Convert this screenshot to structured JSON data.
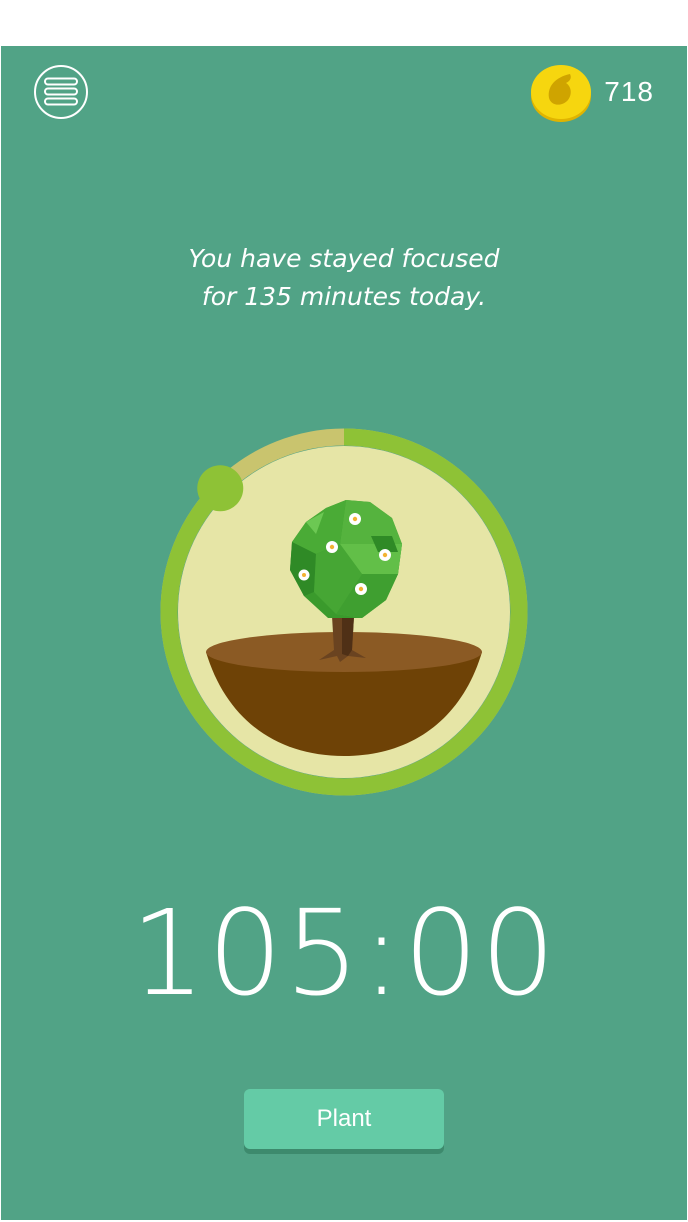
{
  "header": {
    "menu_icon": "hamburger-menu-icon",
    "coin_icon": "gold-coin-icon",
    "coin_count": "718"
  },
  "focus_message": {
    "line1": "You have stayed focused",
    "line2": "for 135 minutes today."
  },
  "tree": {
    "illustration": "tree-with-flowers-on-soil",
    "progress_fraction": 0.875
  },
  "timer": {
    "display": "105:00"
  },
  "actions": {
    "plant_label": "Plant"
  },
  "colors": {
    "background": "#51a386",
    "ring_progress": "#8ec236",
    "ring_track": "#c9c46e",
    "disc": "#e6e5a6",
    "soil_top": "#8b5a24",
    "soil_bottom": "#6e4206",
    "coin": "#f6d60f",
    "plant_button": "#64cba6"
  }
}
